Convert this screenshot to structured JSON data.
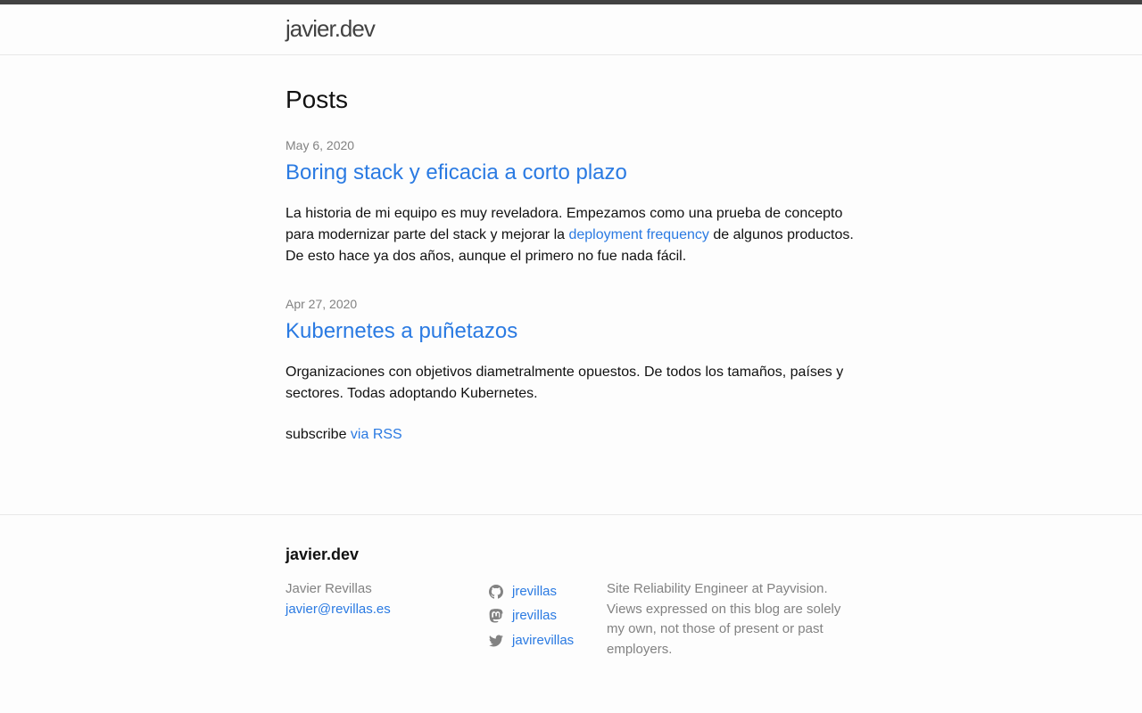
{
  "header": {
    "site_title": "javier.dev"
  },
  "main": {
    "heading": "Posts",
    "posts": [
      {
        "date": "May 6, 2020",
        "title": "Boring stack y eficacia a corto plazo",
        "excerpt_before": "La historia de mi equipo es muy reveladora. Empezamos como una prueba de concepto para modernizar parte del stack y mejorar la ",
        "excerpt_link": "deployment frequency",
        "excerpt_after": " de algunos productos. De esto hace ya dos años, aunque el primero no fue nada fácil."
      },
      {
        "date": "Apr 27, 2020",
        "title": "Kubernetes a puñetazos",
        "excerpt": "Organizaciones con objetivos diametralmente opuestos. De todos los tamaños, países y sectores. Todas adoptando Kubernetes."
      }
    ],
    "rss": {
      "prefix": "subscribe ",
      "link": "via RSS"
    }
  },
  "footer": {
    "heading": "javier.dev",
    "name": "Javier Revillas",
    "email": "javier@revillas.es",
    "social": [
      {
        "icon": "github-icon",
        "label": "jrevillas"
      },
      {
        "icon": "mastodon-icon",
        "label": "jrevillas"
      },
      {
        "icon": "twitter-icon",
        "label": "javirevillas"
      }
    ],
    "description": "Site Reliability Engineer at Payvision. Views expressed on this blog are solely my own, not those of present or past employers."
  },
  "colors": {
    "link": "#2a7ae2",
    "muted": "#828282",
    "header_border": "#424242"
  }
}
